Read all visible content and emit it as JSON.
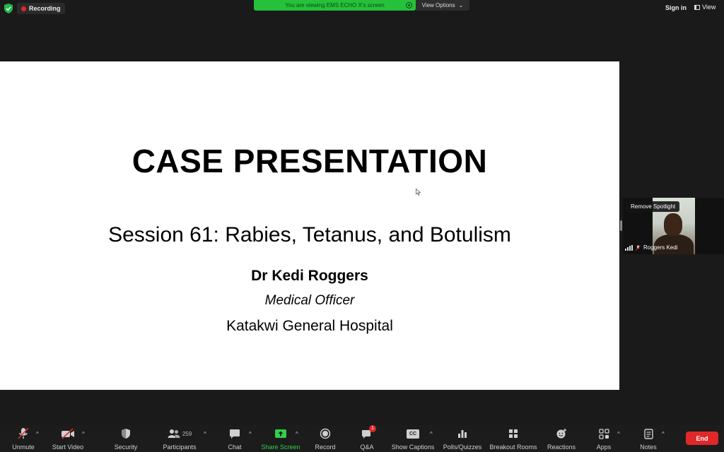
{
  "topbar": {
    "recording_label": "Recording",
    "share_banner": "You are viewing EMS ECHO X's screen",
    "view_options": "View Options",
    "view_options_caret": "⌄",
    "sign_in": "Sign in",
    "view": "View"
  },
  "slide": {
    "title": "CASE PRESENTATION",
    "subtitle": "Session 61: Rabies, Tetanus, and Botulism",
    "author": "Dr Kedi Roggers",
    "role": "Medical Officer",
    "organization": "Katakwi General Hospital"
  },
  "video_tile": {
    "remove_spotlight": "Remove Spotlight",
    "participant_name": "Roggers Kedi"
  },
  "toolbar": {
    "unmute": "Unmute",
    "start_video": "Start Video",
    "security": "Security",
    "participants": "Participants",
    "participants_count": "259",
    "chat": "Chat",
    "share_screen": "Share Screen",
    "record": "Record",
    "qa": "Q&A",
    "qa_badge": "1",
    "show_captions": "Show Captions",
    "cc_glyph": "CC",
    "polls": "Polls/Quizzes",
    "breakout_rooms": "Breakout Rooms",
    "reactions": "Reactions",
    "apps": "Apps",
    "notes": "Notes",
    "end": "End",
    "caret": "^"
  },
  "colors": {
    "share_green": "#25c13a",
    "end_red": "#e02828",
    "recording_red": "#e02828"
  },
  "icons": [
    "shield-icon",
    "recording-dot-icon",
    "stop-share-icon",
    "view-icon",
    "mic-muted-icon",
    "video-off-icon",
    "security-icon",
    "participants-icon",
    "chat-icon",
    "share-screen-icon",
    "record-icon",
    "qa-icon",
    "captions-icon",
    "polls-icon",
    "breakout-rooms-icon",
    "reactions-icon",
    "apps-icon",
    "notes-icon",
    "signal-bars-icon",
    "mic-off-small-icon"
  ]
}
